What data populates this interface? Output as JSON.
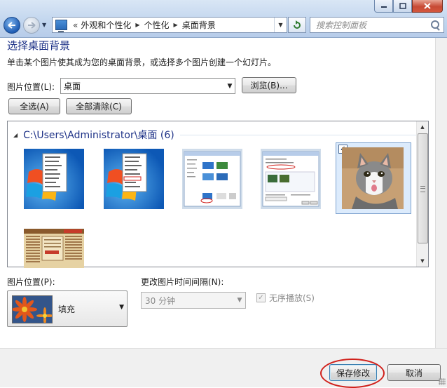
{
  "window": {
    "minimize_icon": "minimize-icon",
    "maximize_icon": "maximize-icon",
    "close_icon": "close-icon"
  },
  "nav": {
    "back_icon": "arrow-left-icon",
    "forward_icon": "arrow-right-icon"
  },
  "address": {
    "overflow": "«",
    "crumbs": [
      "外观和个性化",
      "个性化",
      "桌面背景"
    ]
  },
  "search": {
    "placeholder": "搜索控制面板"
  },
  "main": {
    "heading": "选择桌面背景",
    "description": "单击某个图片使其成为您的桌面背景，或选择多个图片创建一个幻灯片。",
    "location_label": "图片位置(L):",
    "location_value": "桌面",
    "browse_button": "浏览(B)...",
    "select_all_button": "全选(A)",
    "clear_all_button": "全部清除(C)"
  },
  "gallery": {
    "group_title": "C:\\Users\\Administrator\\桌面 (6)",
    "items": [
      {
        "kind": "win7-desktop-menu",
        "selected": false
      },
      {
        "kind": "win7-desktop-menu-highlight",
        "selected": false
      },
      {
        "kind": "control-panel-screenshot",
        "selected": false
      },
      {
        "kind": "desktop-background-screenshot",
        "selected": false
      },
      {
        "kind": "cat-photo",
        "selected": true
      },
      {
        "kind": "newspaper-scan",
        "selected": false
      }
    ]
  },
  "options": {
    "position_label": "图片位置(P):",
    "position_value": "填充",
    "interval_label": "更改图片时间间隔(N):",
    "interval_value": "30 分钟",
    "shuffle_label": "无序播放(S)",
    "shuffle_checked": true
  },
  "footer": {
    "save_button": "保存修改",
    "cancel_button": "取消"
  },
  "colors": {
    "heading": "#1e3287",
    "annotation_ring": "#d0201b"
  }
}
